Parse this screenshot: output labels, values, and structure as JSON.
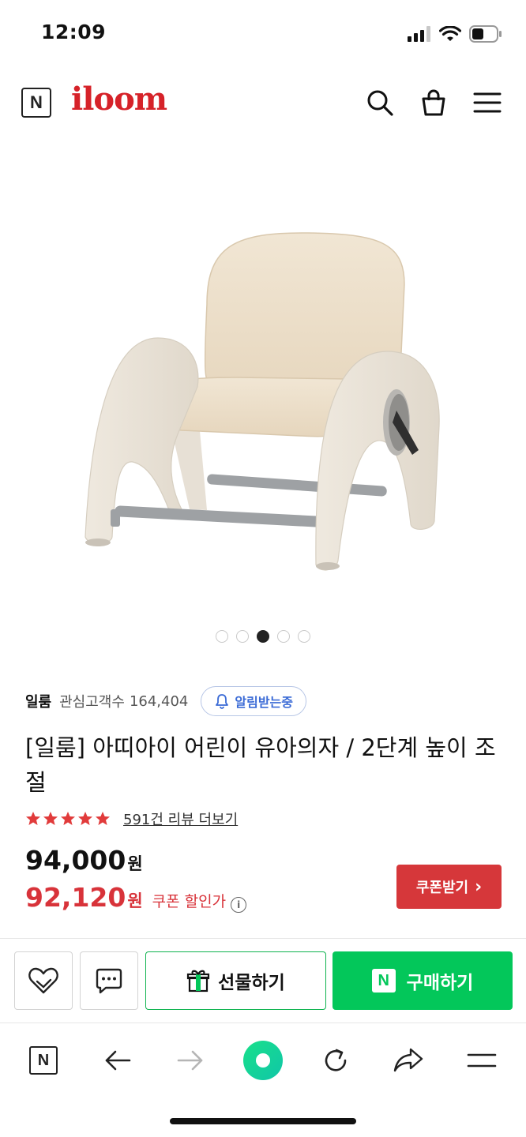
{
  "status_bar": {
    "time": "12:09"
  },
  "header": {
    "brand_badge": "N",
    "brand": "iloom"
  },
  "gallery": {
    "image_alt": "beige kids chair with grey bars",
    "dot_count": 5,
    "active_index": 2
  },
  "store": {
    "name": "일룸",
    "follower_label": "관심고객수",
    "follower_count": "164,404",
    "alarm_label": "알림받는중"
  },
  "product": {
    "title": "[일룸] 아띠아이 어린이 유아의자 / 2단계 높이 조절"
  },
  "rating": {
    "stars": 5,
    "review_text": "591건 리뷰 더보기"
  },
  "price": {
    "original": "94,000",
    "original_unit": "원",
    "sale": "92,120",
    "sale_unit": "원",
    "sale_label": "쿠폰 할인가",
    "info_glyph": "i"
  },
  "coupon_button": {
    "label": "쿠폰받기",
    "chevron": "›"
  },
  "actions": {
    "gift_label": "선물하기",
    "buy_badge": "N",
    "buy_label": "구매하기"
  },
  "browser_nav": {
    "badge": "N"
  },
  "colors": {
    "brand_red": "#d62229",
    "sale_red": "#d8333a",
    "coupon_bg": "#d6373a",
    "naver_green": "#03c75a",
    "alarm_blue": "#3b6bd6"
  }
}
